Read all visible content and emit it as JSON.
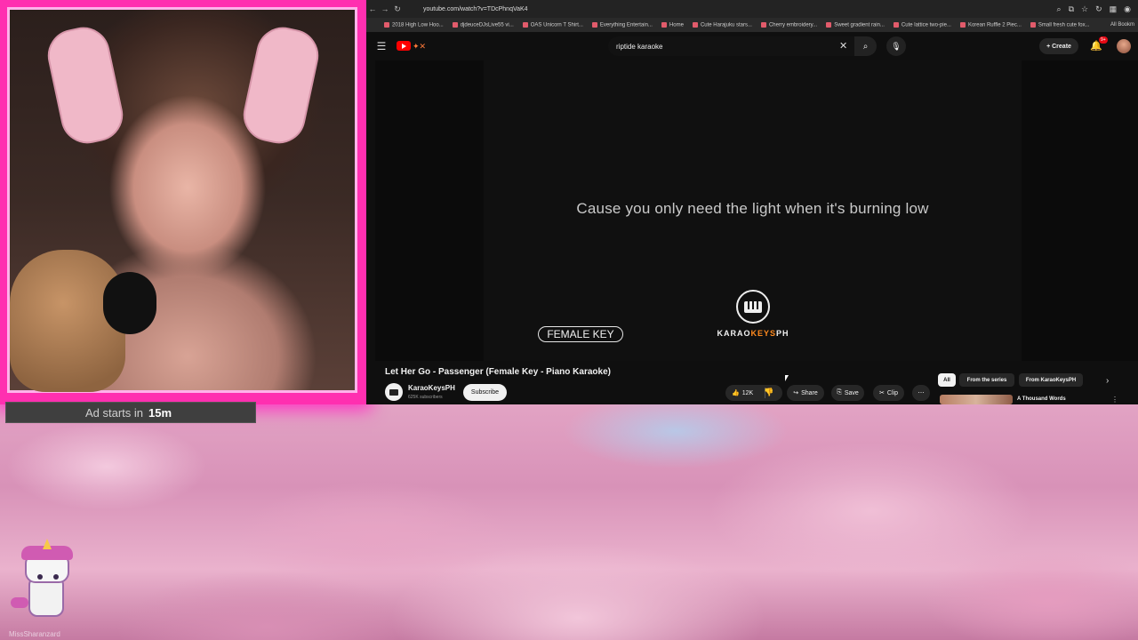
{
  "overlay": {
    "ad_label": "Ad starts in",
    "ad_time": "15m",
    "streamer_name": "MissSharanzard"
  },
  "browser": {
    "url": "youtube.com/watch?v=TDcPhnqVaK4",
    "bookmarks": [
      "2018 High Low Hoo...",
      "djdeuceDJsLive55 vi...",
      "OAS Unicorn T Shirt...",
      "Everything Entertain...",
      "Home",
      "Cute Harajuku stars...",
      "Cherry embroidery...",
      "Sweet gradient rain...",
      "Cute lattice two-pie...",
      "Korean Ruffle 2 Piec...",
      "Small fresh cute fox..."
    ],
    "all_bookmarks": "All Bookm"
  },
  "youtube": {
    "search_query": "riptide karaoke",
    "create_label": "Create",
    "notifications_badge": "9+",
    "video": {
      "lyric_line": "Cause you only need the light when it's burning low",
      "key_badge": "FEMALE KEY",
      "logo_text_a": "KARAO",
      "logo_text_b": "KEYS",
      "logo_text_c": "PH",
      "title": "Let Her Go - Passenger (Female Key - Piano Karaoke)"
    },
    "channel": {
      "name": "KaraoKeysPH",
      "subscribers": "625K subscribers",
      "subscribe_label": "Subscribe"
    },
    "actions": {
      "likes": "12K",
      "share": "Share",
      "save": "Save",
      "clip": "Clip"
    },
    "chips": [
      "All",
      "From the series",
      "From KaraoKeysPH"
    ],
    "recommendation_title": "A Thousand Words"
  },
  "colors": {
    "frame_pink": "#ff2fb0",
    "yt_red": "#ff0000",
    "logo_orange": "#ff8a1e"
  }
}
